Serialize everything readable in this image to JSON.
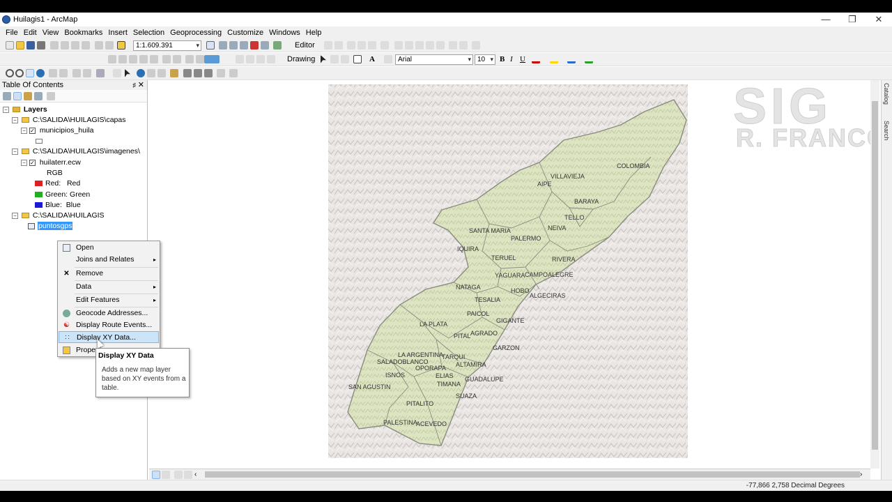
{
  "window": {
    "title": "Huilagis1 - ArcMap",
    "minimize": "—",
    "restore": "❐",
    "close": "✕"
  },
  "menu": [
    "File",
    "Edit",
    "View",
    "Bookmarks",
    "Insert",
    "Selection",
    "Geoprocessing",
    "Customize",
    "Windows",
    "Help"
  ],
  "toolbar": {
    "scale": "1:1.609.391",
    "editor": "Editor",
    "drawing": "Drawing",
    "font": "Arial",
    "font_size": "10",
    "bold": "B",
    "italic": "I",
    "underline": "U",
    "text_tool": "A"
  },
  "toc": {
    "title": "Table Of Contents",
    "root": "Layers",
    "groups": [
      {
        "path": "C:\\SALIDA\\HUILAGIS\\capas",
        "layer": "municipios_huila"
      },
      {
        "path": "C:\\SALIDA\\HUILAGIS\\imagenes\\",
        "layer": "huilaterr.ecw",
        "rgb": "RGB",
        "bands": [
          {
            "label": "Red:",
            "value": "Red",
            "color": "#e02020"
          },
          {
            "label": "Green:",
            "value": "Green",
            "color": "#22b022"
          },
          {
            "label": "Blue:",
            "value": "Blue",
            "color": "#1a1ad6"
          }
        ]
      },
      {
        "path": "C:\\SALIDA\\HUILAGIS",
        "layer": "puntosgps"
      }
    ]
  },
  "context_menu": {
    "items": [
      "Open",
      "Joins and Relates",
      "Remove",
      "Data",
      "Edit Features",
      "Geocode Addresses...",
      "Display Route Events...",
      "Display XY Data...",
      "Properties..."
    ],
    "highlighted": "Display XY Data..."
  },
  "tooltip": {
    "title": "Display XY Data",
    "body": "Adds a new map layer based on XY events from a table."
  },
  "watermark": {
    "line1": "SIG",
    "line2": "R. FRANCO"
  },
  "dock": {
    "catalog": "Catalog",
    "search": "Search"
  },
  "map_labels": [
    "COLOMBIA",
    "VILLAVIEJA",
    "AIPE",
    "BARAYA",
    "TELLO",
    "NEIVA",
    "SANTA MARIA",
    "PALERMO",
    "IQUIRA",
    "TERUEL",
    "RIVERA",
    "YAGUARA",
    "CAMPOALEGRE",
    "NATAGA",
    "HOBO",
    "ALGECIRAS",
    "TESALIA",
    "PAICOL",
    "GIGANTE",
    "LA PLATA",
    "PITAL",
    "AGRADO",
    "GARZON",
    "LA ARGENTINA",
    "SALADOBLANCO",
    "OPORAPA",
    "TARQUI",
    "ALTAMIRA",
    "ISNOS",
    "ELIAS",
    "TIMANA",
    "GUADALUPE",
    "SAN AGUSTIN",
    "SUAZA",
    "PITALITO",
    "PALESTINA",
    "ACEVEDO"
  ],
  "status": "-77,866  2,758 Decimal Degrees"
}
